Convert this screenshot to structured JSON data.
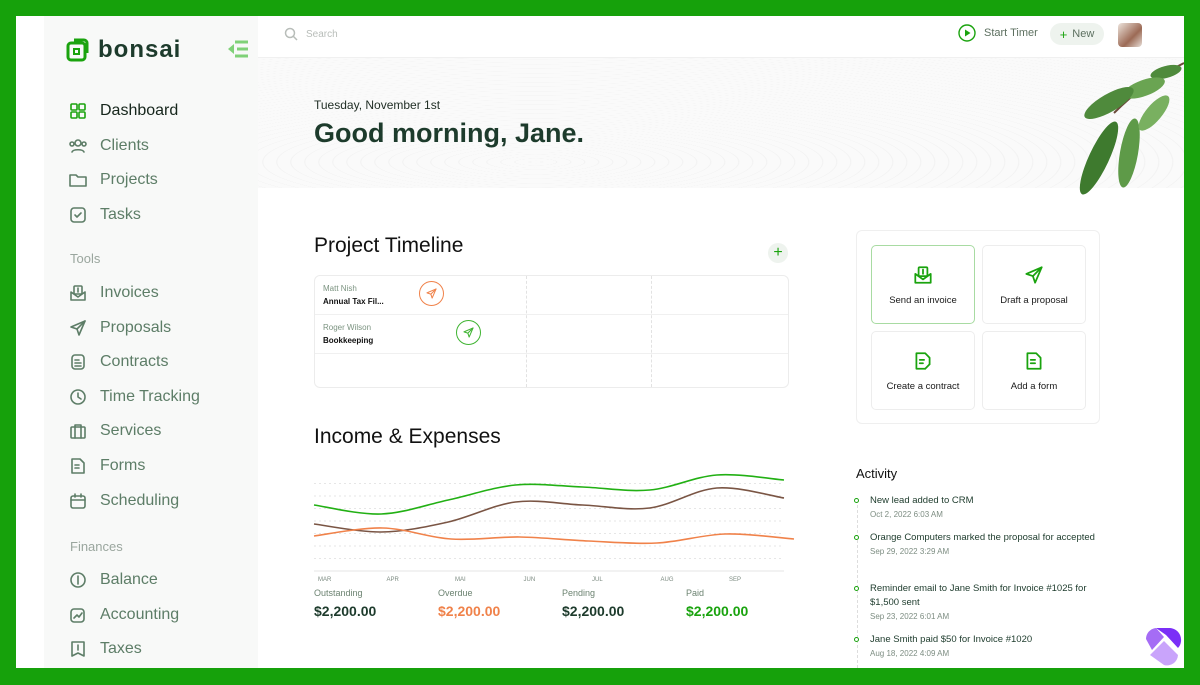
{
  "brand": {
    "name": "bonsai",
    "accent": "#1aa30e"
  },
  "sidebar": {
    "items": [
      {
        "label": "Dashboard",
        "icon": "grid-icon",
        "active": true
      },
      {
        "label": "Clients",
        "icon": "users-icon"
      },
      {
        "label": "Projects",
        "icon": "folder-icon"
      },
      {
        "label": "Tasks",
        "icon": "checkbox-icon"
      }
    ],
    "tools_label": "Tools",
    "tools": [
      {
        "label": "Invoices",
        "icon": "invoice-icon"
      },
      {
        "label": "Proposals",
        "icon": "send-icon"
      },
      {
        "label": "Contracts",
        "icon": "document-icon"
      },
      {
        "label": "Time Tracking",
        "icon": "clock-icon"
      },
      {
        "label": "Services",
        "icon": "briefcase-icon"
      },
      {
        "label": "Forms",
        "icon": "form-icon"
      },
      {
        "label": "Scheduling",
        "icon": "calendar-icon"
      }
    ],
    "finances_label": "Finances",
    "finances": [
      {
        "label": "Balance",
        "icon": "dollar-circle-icon"
      },
      {
        "label": "Accounting",
        "icon": "chart-icon"
      },
      {
        "label": "Taxes",
        "icon": "tax-icon"
      }
    ]
  },
  "topbar": {
    "search_placeholder": "Search",
    "start_timer": "Start Timer",
    "new": "New"
  },
  "hero": {
    "date": "Tuesday, November 1st",
    "greeting": "Good morning, Jane."
  },
  "timeline": {
    "title": "Project Timeline",
    "rows": [
      {
        "client": "Matt Nish",
        "project": "Annual Tax Fil...",
        "status_color": "#f0824a"
      },
      {
        "client": "Roger Wilson",
        "project": "Bookkeeping",
        "status_color": "#3fb432"
      }
    ]
  },
  "income": {
    "title": "Income & Expenses",
    "stats": [
      {
        "label": "Outstanding",
        "value": "$2,200.00",
        "color": "#1d3b2c"
      },
      {
        "label": "Overdue",
        "value": "$2,200.00",
        "color": "#f0824a"
      },
      {
        "label": "Pending",
        "value": "$2,200.00",
        "color": "#1d3b2c"
      },
      {
        "label": "Paid",
        "value": "$2,200.00",
        "color": "#1aa30e"
      }
    ]
  },
  "chart_data": {
    "type": "line",
    "categories": [
      "MAR",
      "APR",
      "MAI",
      "JUN",
      "JUL",
      "AUG",
      "SEP"
    ],
    "grid": true,
    "series": [
      {
        "color": "#22b014",
        "values": [
          66,
          57,
          71,
          86,
          84,
          81,
          96,
          91
        ]
      },
      {
        "color": "#7a5544",
        "values": [
          47,
          39,
          49,
          69,
          66,
          63,
          83,
          73
        ]
      },
      {
        "color": "#f0824a",
        "values": [
          35,
          43,
          32,
          34,
          30,
          28,
          37,
          32
        ]
      }
    ]
  },
  "quick_actions": [
    {
      "label": "Send an invoice",
      "icon": "invoice-icon"
    },
    {
      "label": "Draft a proposal",
      "icon": "send-icon"
    },
    {
      "label": "Create a contract",
      "icon": "contract-icon"
    },
    {
      "label": "Add a form",
      "icon": "form-icon"
    }
  ],
  "activity": {
    "title": "Activity",
    "items": [
      {
        "text": "New lead added to CRM",
        "date": "Oct 2, 2022  6:03 AM"
      },
      {
        "text": "Orange Computers marked the proposal for accepted",
        "date": "Sep 29, 2022  3:29 AM"
      },
      {
        "text": "Reminder email to Jane Smith for Invoice #1025 for $1,500 sent",
        "date": "Sep 23, 2022  6:01 AM"
      },
      {
        "text": "Jane Smith paid $50 for Invoice #1020",
        "date": "Aug 18, 2022  4:09 AM"
      }
    ]
  }
}
